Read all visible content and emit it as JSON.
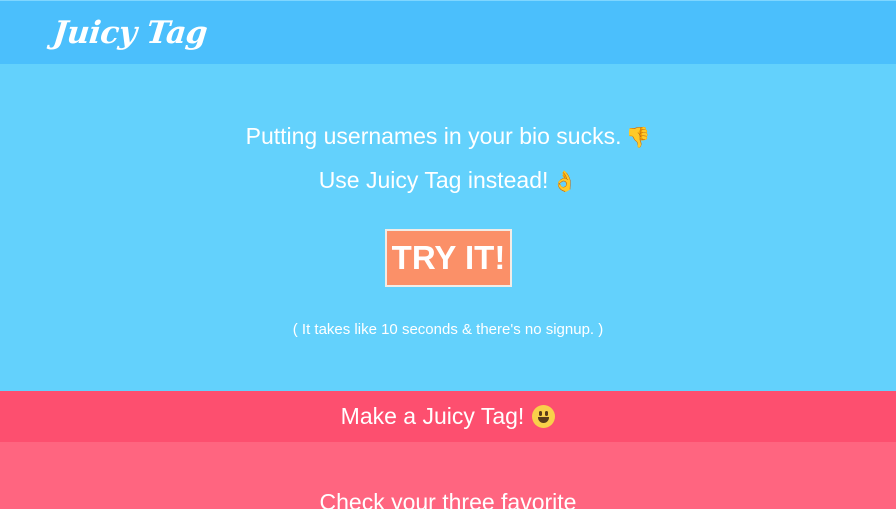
{
  "navbar": {
    "logo": "Juicy Tag"
  },
  "hero": {
    "line1": "Putting usernames in your bio sucks.",
    "line1_emoji": "👎",
    "line2": "Use Juicy Tag instead!",
    "line2_emoji": "👌",
    "cta_label": "TRY IT!",
    "note": "( It takes like 10 seconds & there's no signup. )"
  },
  "make_section": {
    "label": "Make a Juicy Tag!"
  },
  "pick_section": {
    "heading": "Check your three favorite"
  },
  "colors": {
    "navbar": "#4bbffc",
    "hero": "#63d1fc",
    "cta": "#fb9068",
    "make_bar": "#fd4f6f",
    "pink_section": "#ff6580"
  }
}
